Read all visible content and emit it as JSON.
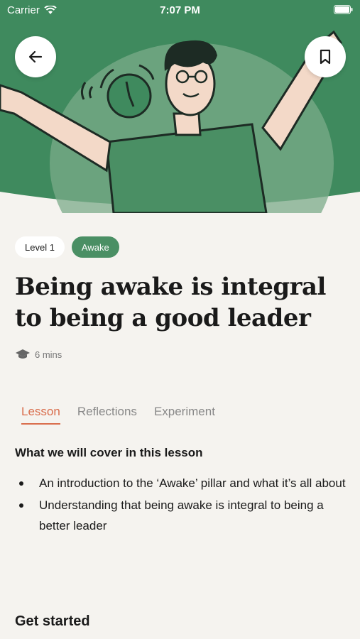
{
  "status_bar": {
    "carrier": "Carrier",
    "time": "7:07 PM"
  },
  "colors": {
    "hero_green": "#3f8a5e",
    "accent_orange": "#d96d4c",
    "tag_green": "#4a8f64"
  },
  "header": {
    "back_icon": "arrow-left-icon",
    "bookmark_icon": "bookmark-icon"
  },
  "tags": {
    "level": "Level 1",
    "pillar": "Awake"
  },
  "lesson": {
    "title": "Being awake is integral to being a good leader",
    "duration": "6 mins"
  },
  "tabs": [
    {
      "label": "Lesson",
      "active": true
    },
    {
      "label": "Reflections",
      "active": false
    },
    {
      "label": "Experiment",
      "active": false
    }
  ],
  "content": {
    "heading": "What we will cover in this lesson",
    "bullets": [
      "An introduction to the ‘Awake’ pillar and what it’s all about",
      "Understanding that being awake is integral to being a better leader"
    ],
    "get_started": "Get started"
  }
}
